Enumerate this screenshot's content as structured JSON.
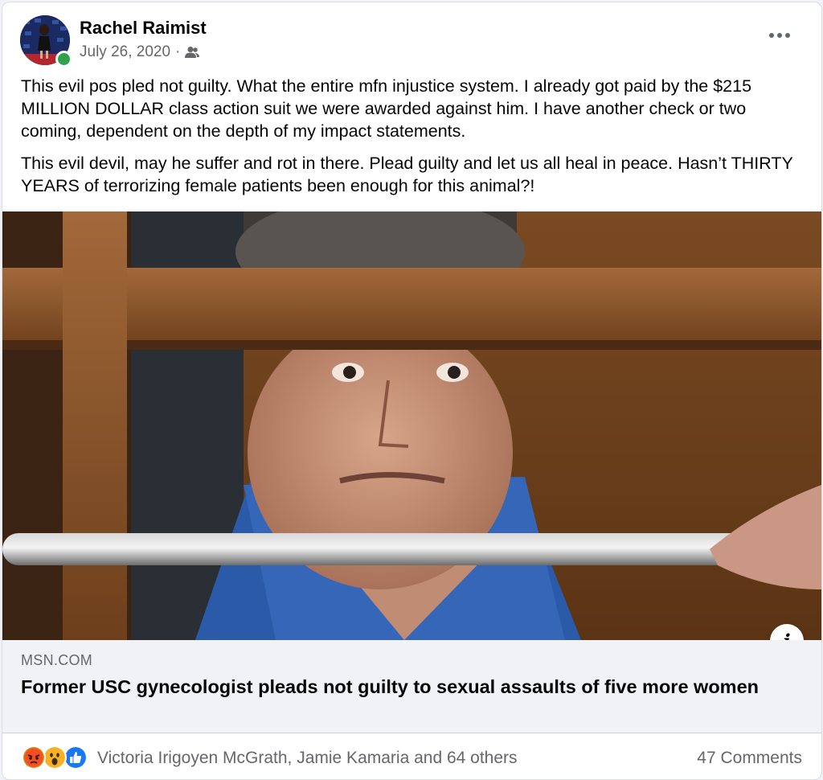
{
  "post": {
    "author": "Rachel Raimist",
    "date": "July 26, 2020",
    "separator": "·",
    "audience_icon": "friends-icon",
    "paragraphs": [
      "This evil pos pled not guilty. What the entire mfn injustice system. I already got paid by the $215 MILLION DOLLAR class action suit we were awarded against him. I have another check or two coming, dependent on the depth of my impact statements.",
      "This evil devil, may he suffer and rot in there. Plead guilty and let us all heal in peace. Hasn’t THIRTY YEARS of terrorizing female patients been enough for this animal?!"
    ]
  },
  "link": {
    "domain": "MSN.COM",
    "title": "Former USC gynecologist pleads not guilty to sexual assaults of five more women",
    "info_icon": "i"
  },
  "footer": {
    "reactions": [
      "angry",
      "wow",
      "like"
    ],
    "reaction_names": "Victoria Irigoyen McGrath, Jamie Kamaria and 64 others",
    "comments": "47 Comments"
  },
  "colors": {
    "online": "#31a24c",
    "like": "#1877f2",
    "angry": "#e9710f",
    "wow": "#f7b125"
  }
}
